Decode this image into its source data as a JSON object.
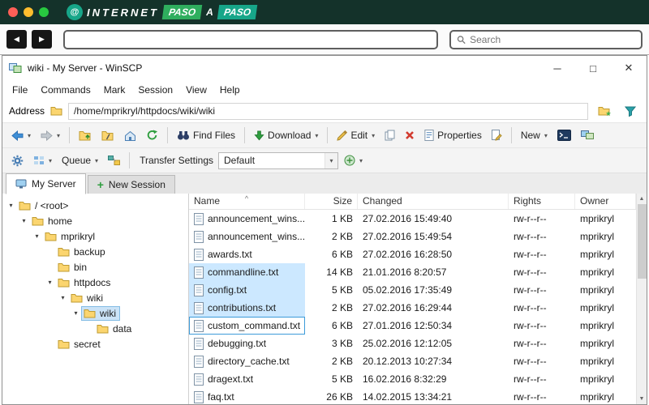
{
  "topbar": {
    "logo": {
      "word1": "INTERNET",
      "word2": "PASO",
      "word3": "A",
      "word4": "PASO"
    }
  },
  "browser": {
    "search_placeholder": "Search"
  },
  "winscp": {
    "title": "wiki - My Server - WinSCP",
    "menu": [
      "File",
      "Commands",
      "Mark",
      "Session",
      "View",
      "Help"
    ],
    "address": {
      "label": "Address",
      "path": "/home/mprikryl/httpdocs/wiki/wiki"
    },
    "toolbar": {
      "find_files": "Find Files",
      "download": "Download",
      "edit": "Edit",
      "properties": "Properties",
      "new": "New"
    },
    "toolbar2": {
      "queue": "Queue",
      "transfer_label": "Transfer Settings",
      "transfer_value": "Default"
    },
    "tabs": [
      {
        "label": "My Server",
        "active": true
      },
      {
        "label": "New Session",
        "active": false
      }
    ],
    "tree": [
      {
        "label": "/ <root>",
        "depth": 0,
        "expanded": true,
        "selected": false
      },
      {
        "label": "home",
        "depth": 1,
        "expanded": true,
        "selected": false
      },
      {
        "label": "mprikryl",
        "depth": 2,
        "expanded": true,
        "selected": false
      },
      {
        "label": "backup",
        "depth": 3,
        "expanded": false,
        "selected": false
      },
      {
        "label": "bin",
        "depth": 3,
        "expanded": false,
        "selected": false
      },
      {
        "label": "httpdocs",
        "depth": 3,
        "expanded": true,
        "selected": false
      },
      {
        "label": "wiki",
        "depth": 4,
        "expanded": true,
        "selected": false
      },
      {
        "label": "wiki",
        "depth": 5,
        "expanded": true,
        "selected": true
      },
      {
        "label": "data",
        "depth": 6,
        "expanded": false,
        "selected": false
      },
      {
        "label": "secret",
        "depth": 3,
        "expanded": false,
        "selected": false
      }
    ],
    "files": {
      "columns": [
        "Name",
        "Size",
        "Changed",
        "Rights",
        "Owner"
      ],
      "rows": [
        {
          "name": "announcement_wins...",
          "size": "1 KB",
          "changed": "27.02.2016 15:49:40",
          "rights": "rw-r--r--",
          "owner": "mprikryl",
          "state": "none"
        },
        {
          "name": "announcement_wins...",
          "size": "2 KB",
          "changed": "27.02.2016 15:49:54",
          "rights": "rw-r--r--",
          "owner": "mprikryl",
          "state": "none"
        },
        {
          "name": "awards.txt",
          "size": "6 KB",
          "changed": "27.02.2016 16:28:50",
          "rights": "rw-r--r--",
          "owner": "mprikryl",
          "state": "none"
        },
        {
          "name": "commandline.txt",
          "size": "14 KB",
          "changed": "21.01.2016 8:20:57",
          "rights": "rw-r--r--",
          "owner": "mprikryl",
          "state": "selected"
        },
        {
          "name": "config.txt",
          "size": "5 KB",
          "changed": "05.02.2016 17:35:49",
          "rights": "rw-r--r--",
          "owner": "mprikryl",
          "state": "selected"
        },
        {
          "name": "contributions.txt",
          "size": "2 KB",
          "changed": "27.02.2016 16:29:44",
          "rights": "rw-r--r--",
          "owner": "mprikryl",
          "state": "selected"
        },
        {
          "name": "custom_command.txt",
          "size": "6 KB",
          "changed": "27.01.2016 12:50:34",
          "rights": "rw-r--r--",
          "owner": "mprikryl",
          "state": "focused"
        },
        {
          "name": "debugging.txt",
          "size": "3 KB",
          "changed": "25.02.2016 12:12:05",
          "rights": "rw-r--r--",
          "owner": "mprikryl",
          "state": "none"
        },
        {
          "name": "directory_cache.txt",
          "size": "2 KB",
          "changed": "20.12.2013 10:27:34",
          "rights": "rw-r--r--",
          "owner": "mprikryl",
          "state": "none"
        },
        {
          "name": "dragext.txt",
          "size": "5 KB",
          "changed": "16.02.2016 8:32:29",
          "rights": "rw-r--r--",
          "owner": "mprikryl",
          "state": "none"
        },
        {
          "name": "faq.txt",
          "size": "26 KB",
          "changed": "14.02.2015 13:34:21",
          "rights": "rw-r--r--",
          "owner": "mprikryl",
          "state": "none"
        }
      ]
    }
  },
  "colors": {
    "topbar_bg": "#14322a",
    "logo_green": "#2fae5e",
    "logo_teal": "#17a689",
    "selection_blue": "#cce8ff",
    "folder_yellow": "#fbd56f"
  }
}
